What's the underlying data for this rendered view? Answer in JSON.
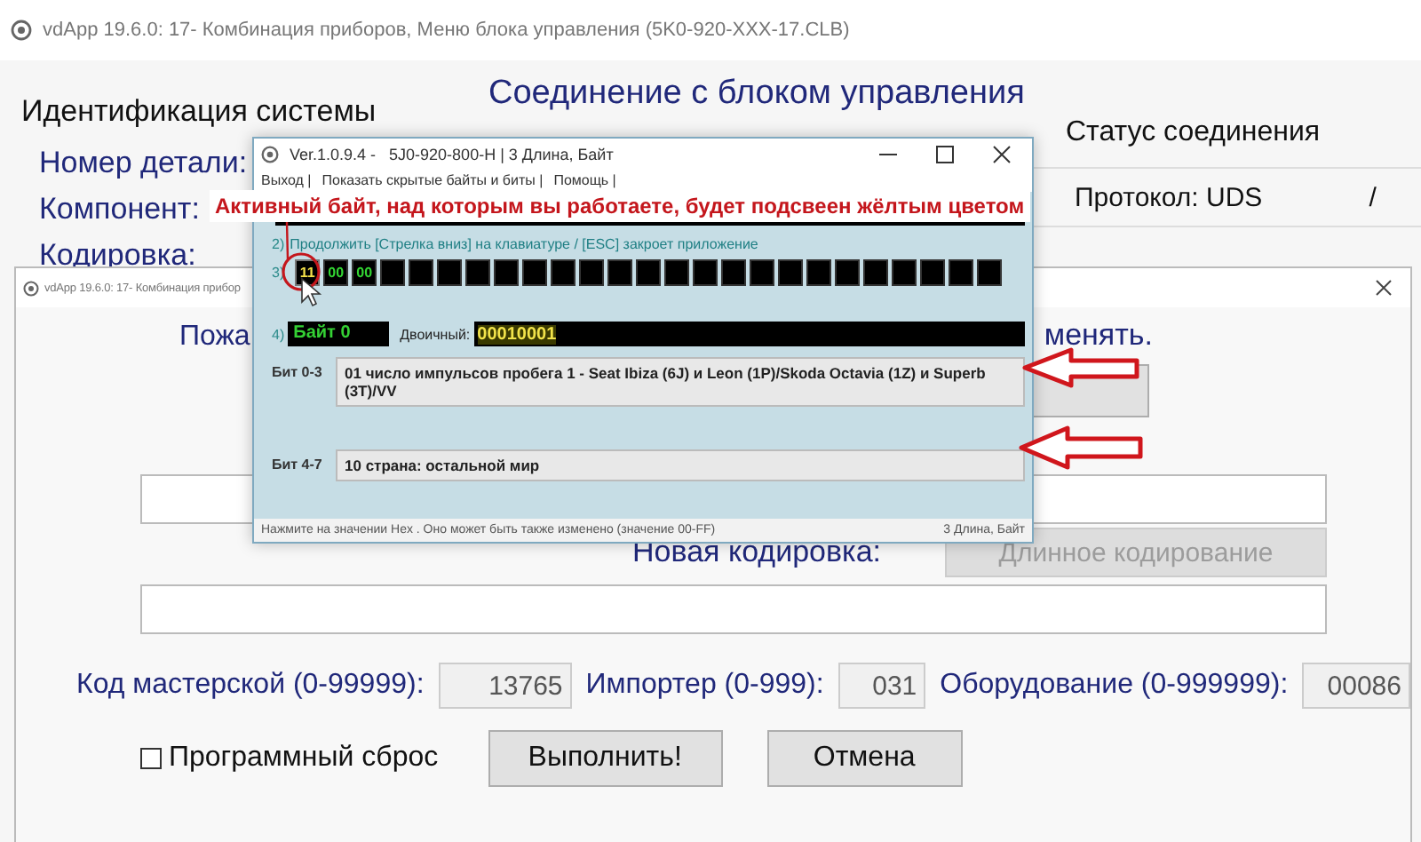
{
  "main_window": {
    "title": "vdApp 19.6.0: 17- Комбинация приборов,  Меню блока управления (5K0-920-XXX-17.CLB)",
    "heading": "Соединение с блоком управления",
    "section_title": "Идентификация системы",
    "labels": [
      "Номер детали:",
      "Компонент:",
      "Кодировка:"
    ],
    "status_title": "Статус соединения",
    "protocol": "Протокол: UDS",
    "status_value": "/"
  },
  "coding_window": {
    "title": "vdApp 19.6.0: 17- Комбинация прибор",
    "prompt_start": "Пожа",
    "prompt_end": "менять.",
    "new_coding_label": "Новая кодировка:",
    "long_coding_button": {
      "label": "Длинное кодирование",
      "disabled": true
    },
    "fields": [
      {
        "label": "Код мастерской (0-99999):",
        "value": "13765"
      },
      {
        "label": "Импортер (0-999):",
        "value": "031"
      },
      {
        "label": "Оборудование (0-999999):",
        "value": "00086"
      }
    ],
    "reset": {
      "label": "Программный сброс",
      "checked": false
    },
    "buttons": [
      "Выполнить!",
      "Отмена"
    ]
  },
  "popup": {
    "title": "Ver.1.0.9.4 -   5J0-920-800-H | 3 Длина, Байт",
    "menu": [
      "Выход |",
      "Показать скрытые байты и биты |",
      "Помощь |"
    ],
    "step_2_marker": "2)",
    "step_2": "Продолжить [Стрелка вниз] на клавиатуре / [ESC] закроет приложение",
    "step_3_marker": "3)",
    "bytes": [
      {
        "value": "11",
        "selected": true
      },
      {
        "value": "00",
        "selected": false
      },
      {
        "value": "00",
        "selected": false
      }
    ],
    "step_4_marker": "4)",
    "byte_name": "Байт 0",
    "binary_label": "Двоичный:",
    "binary": "00010001",
    "bits": [
      {
        "label": "Бит 0-3",
        "value": "01 число импульсов пробега 1 - Seat Ibiza (6J) и Leon (1P)/Skoda Octavia (1Z) и Superb (3T)/VV"
      },
      {
        "label": "Бит 4-7",
        "value": "10 страна: остальной мир"
      }
    ],
    "status_hint": "Нажмите на значении Hex . Оно может быть также изменено (значение 00-FF)",
    "status_length": "3 Длина, Байт"
  },
  "annotation": {
    "text": "Активный байт, над которым вы работаете, будет подсвеен жёлтым цветом"
  }
}
